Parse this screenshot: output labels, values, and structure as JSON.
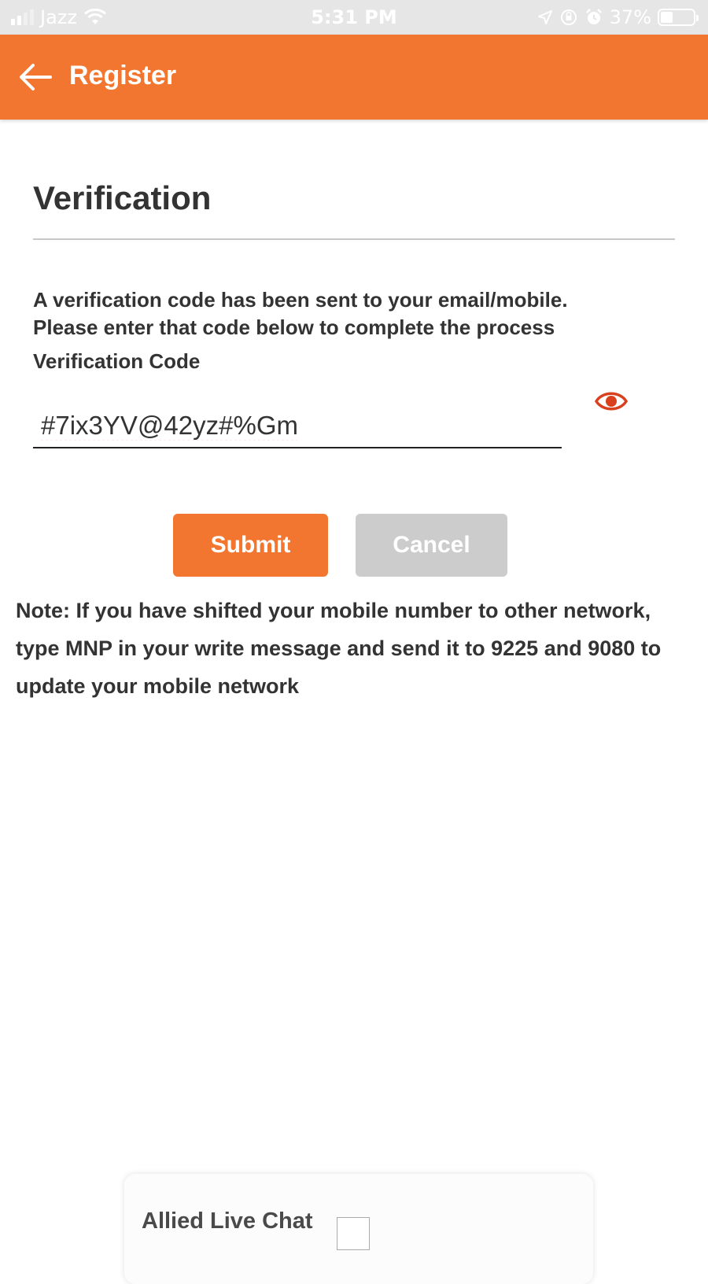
{
  "status_bar": {
    "carrier": "Jazz",
    "time": "5:31 PM",
    "battery": "37%",
    "battery_level": 0.37,
    "icons": [
      "signal-icon",
      "wifi-icon",
      "location-icon",
      "orientation-lock-icon",
      "alarm-icon",
      "battery-icon"
    ]
  },
  "header": {
    "title": "Register",
    "background_color": "#f2762f",
    "back_icon": "arrow-left-icon"
  },
  "verification": {
    "title": "Verification",
    "intro_line1": "A verification code has been sent to your email/mobile.",
    "intro_line2": "Please enter that code below to complete the process",
    "field_label": "Verification Code",
    "code_value": "#7ix3YV@42yz#%Gm",
    "eye_icon": "eye-icon",
    "eye_color": "#d9411e"
  },
  "buttons": {
    "submit_label": "Submit",
    "cancel_label": "Cancel",
    "submit_color": "#f2762f",
    "cancel_color": "#cccccc"
  },
  "note": {
    "text": "Note: If you have shifted your mobile number to other network, type MNP in your write message and send it to 9225 and 9080 to update your mobile network"
  },
  "live_chat": {
    "title": "Allied Live Chat"
  }
}
